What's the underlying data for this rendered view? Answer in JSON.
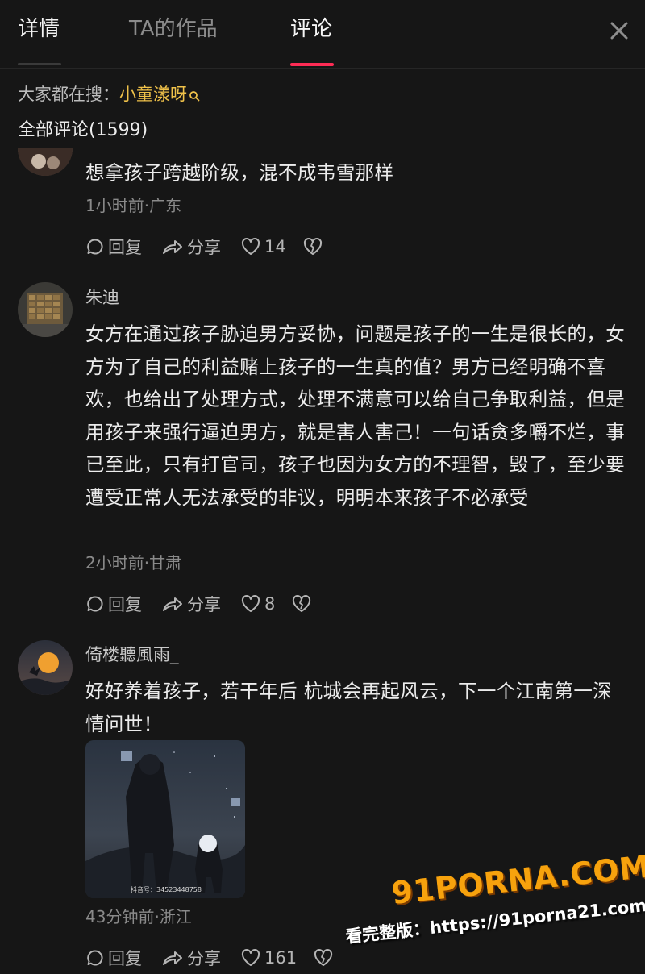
{
  "tabs": {
    "detail": "详情",
    "works": "TA的作品",
    "comments": "评论"
  },
  "hot_search": {
    "prefix": "大家都在搜：",
    "keyword": "小童漾呀"
  },
  "comments_header": "全部评论(1599)",
  "action_labels": {
    "reply": "回复",
    "share": "分享"
  },
  "comments": [
    {
      "text": "想拿孩子跨越阶级，混不成韦雪那样",
      "meta": "1小时前·广东",
      "likes": "14"
    },
    {
      "user": "朱迪",
      "text": "女方在通过孩子胁迫男方妥协，问题是孩子的一生是很长的，女方为了自己的利益赌上孩子的一生真的值？男方已经明确不喜欢，也给出了处理方式，处理不满意可以给自己争取利益，但是用孩子来强行逼迫男方，就是害人害己！一句话贪多嚼不烂，事已至此，只有打官司，孩子也因为女方的不理智，毁了，至少要遭受正常人无法承受的非议，明明本来孩子不必承受",
      "meta": "2小时前·甘肃",
      "likes": "8"
    },
    {
      "user": "倚楼聽風雨_",
      "text": "好好养着孩子，若干年后 杭城会再起风云，下一个江南第一深情问世！",
      "image_caption": "抖音号：34523448758",
      "meta": "43分钟前·浙江",
      "likes": "161"
    }
  ],
  "watermark": {
    "logo": "91PORNA.COM",
    "url_line": "看完整版：https://91porna21.com"
  },
  "colors": {
    "background": "#161616",
    "accent_underline": "#fe2c55",
    "keyword": "#f0c24a",
    "watermark": "#f7a20d"
  }
}
